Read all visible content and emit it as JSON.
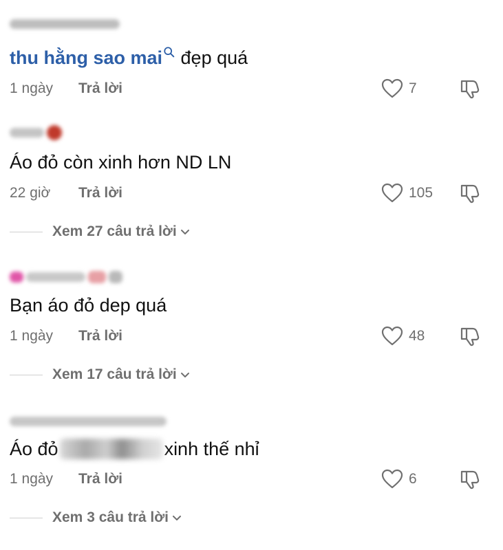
{
  "comments": [
    {
      "username": "",
      "mention": "thu hằng sao mai",
      "text": " đẹp quá",
      "time": "1 ngày",
      "reply_label": "Trả lời",
      "likes": "7",
      "view_replies": ""
    },
    {
      "username": "",
      "text": "Áo đỏ còn xinh hơn ND LN",
      "time": "22 giờ",
      "reply_label": "Trả lời",
      "likes": "105",
      "view_replies": "Xem 27 câu trả lời"
    },
    {
      "username": "",
      "text": "Bạn áo đỏ dep quá",
      "time": "1 ngày",
      "reply_label": "Trả lời",
      "likes": "48",
      "view_replies": "Xem 17 câu trả lời"
    },
    {
      "username": "",
      "text_before": "Áo đỏ",
      "text_after": "xinh thế nhỉ",
      "time": "1 ngày",
      "reply_label": "Trả lời",
      "likes": "6",
      "view_replies": "Xem 3 câu trả lời"
    }
  ],
  "icons": {
    "like": "heart-outline-icon",
    "dislike": "thumbs-down-outline-icon",
    "expand": "chevron-down-icon",
    "mention_search": "search-icon"
  },
  "colors": {
    "mention": "#2d5fa8",
    "text": "#111111",
    "meta": "#6f6f6f"
  }
}
